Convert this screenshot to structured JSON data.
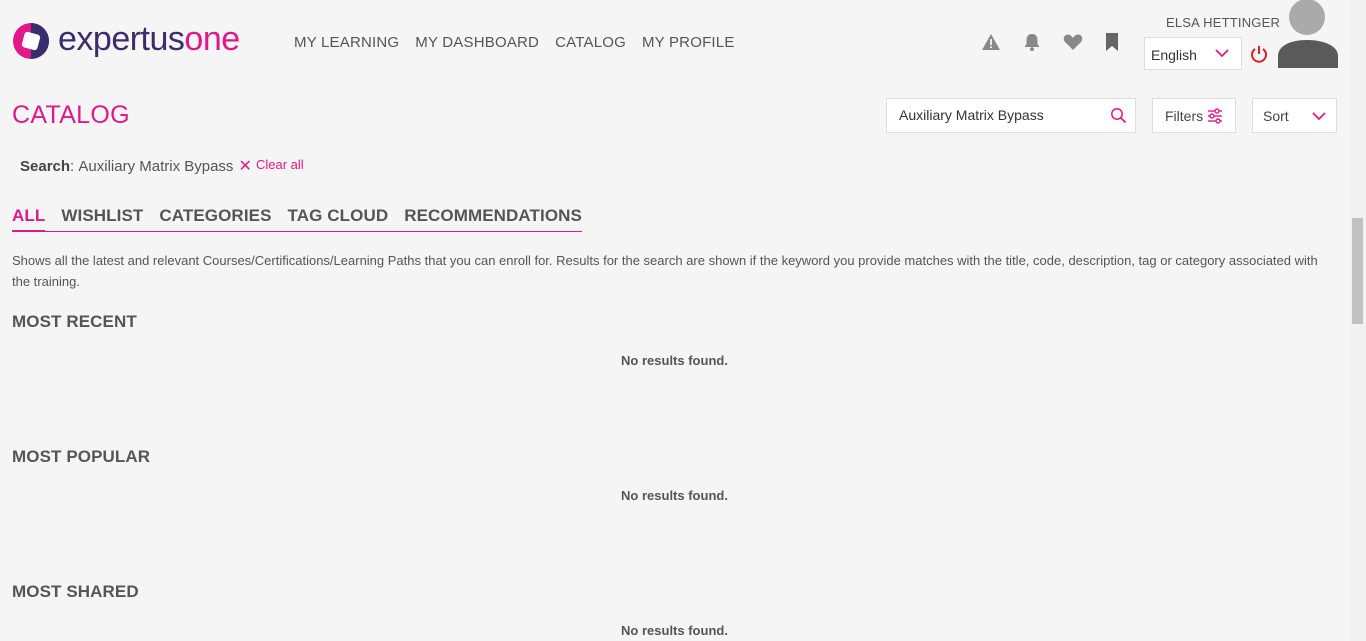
{
  "brand": {
    "logo_part1": "expertus",
    "logo_part2": "one",
    "primary_color": "#e0198a",
    "secondary_color": "#3a2d6e"
  },
  "nav": {
    "items": [
      {
        "label": "MY LEARNING"
      },
      {
        "label": "MY DASHBOARD"
      },
      {
        "label": "CATALOG"
      },
      {
        "label": "MY PROFILE"
      }
    ]
  },
  "header": {
    "icons": [
      "alert-icon",
      "bell-icon",
      "heart-icon",
      "bookmark-icon"
    ],
    "user_name": "ELSA HETTINGER",
    "language": "English"
  },
  "page": {
    "title": "CATALOG",
    "search": {
      "value": "Auxiliary Matrix Bypass"
    },
    "filters_label": "Filters",
    "sort_label": "Sort",
    "active_search": {
      "label": "Search",
      "value": "Auxiliary Matrix Bypass"
    },
    "clear_all": "Clear all"
  },
  "tabs": [
    {
      "label": "ALL",
      "active": true
    },
    {
      "label": "WISHLIST",
      "active": false
    },
    {
      "label": "CATEGORIES",
      "active": false
    },
    {
      "label": "TAG CLOUD",
      "active": false
    },
    {
      "label": "RECOMMENDATIONS",
      "active": false
    }
  ],
  "description": "Shows all the latest and relevant Courses/Certifications/Learning Paths that you can enroll for. Results for the search are shown if the keyword you provide matches with the title, code, description, tag or category associated with the training.",
  "sections": [
    {
      "title": "MOST RECENT",
      "empty_text": "No results found."
    },
    {
      "title": "MOST POPULAR",
      "empty_text": "No results found."
    },
    {
      "title": "MOST SHARED",
      "empty_text": "No results found."
    }
  ]
}
